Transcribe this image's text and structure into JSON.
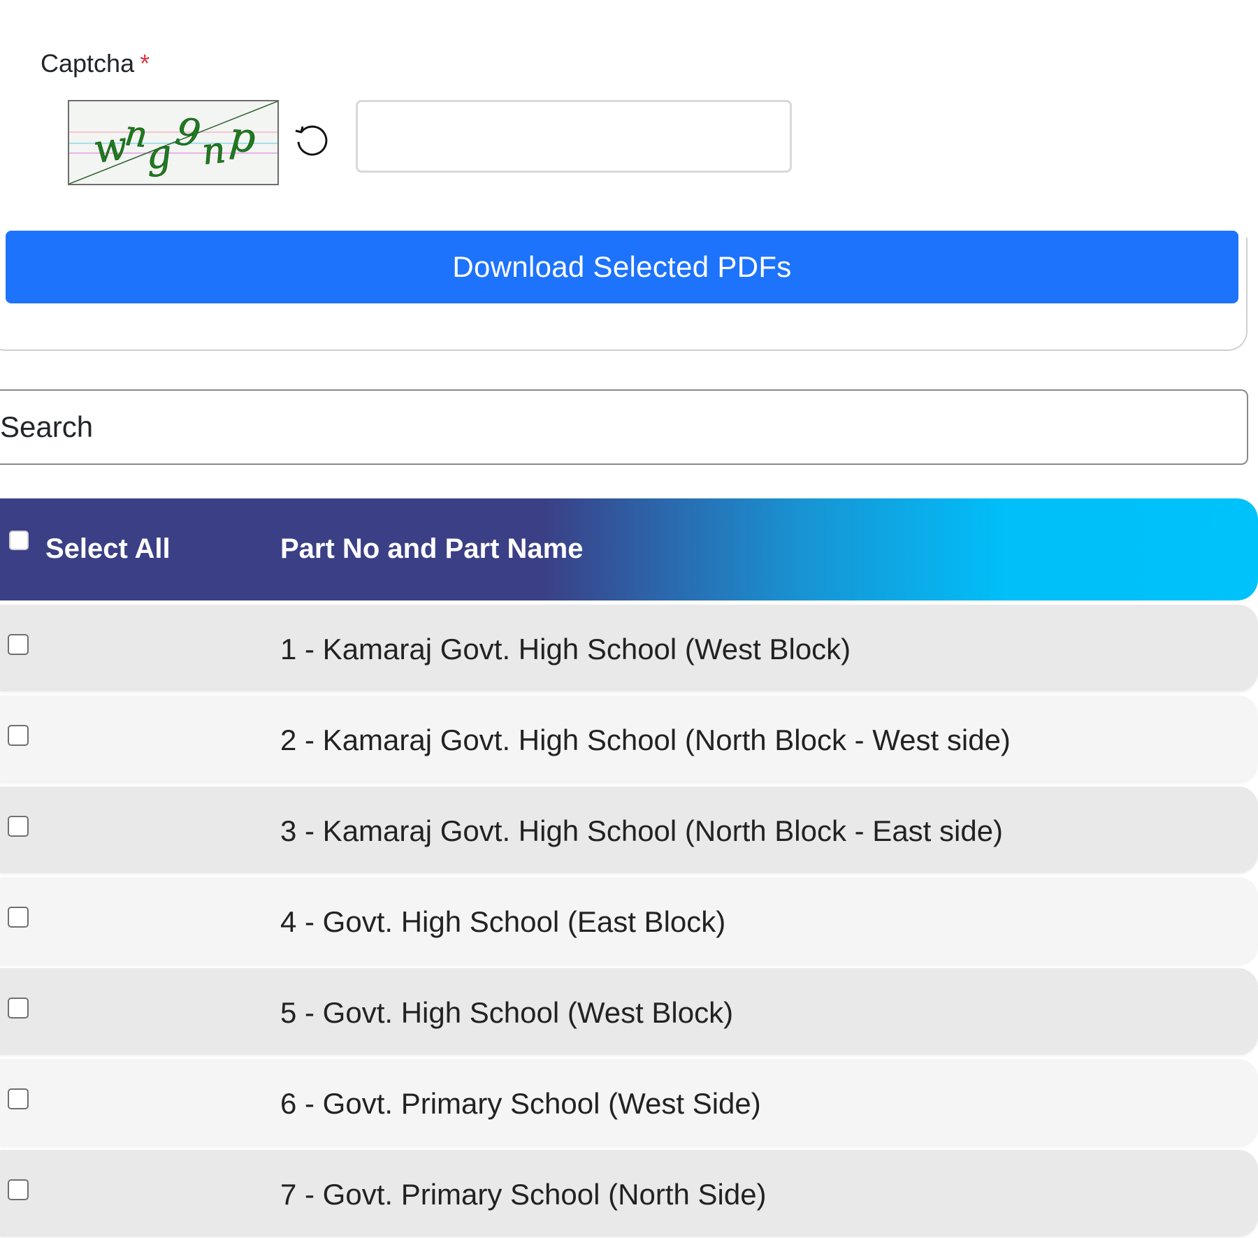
{
  "captcha": {
    "label": "Captcha",
    "required_marker": "*",
    "input_value": "",
    "image_text": "wng9np",
    "refresh_icon": "refresh-icon"
  },
  "download": {
    "button_label": "Download Selected PDFs"
  },
  "search": {
    "placeholder": "Search",
    "value": ""
  },
  "table": {
    "header": {
      "select_all_label": "Select All",
      "part_column_label": "Part No and Part Name"
    },
    "rows": [
      {
        "label": "1 - Kamaraj Govt. High School (West Block)",
        "checked": false
      },
      {
        "label": "2 - Kamaraj Govt. High School (North Block - West side)",
        "checked": false
      },
      {
        "label": "3 - Kamaraj Govt. High School (North Block - East side)",
        "checked": false
      },
      {
        "label": "4 - Govt. High School (East Block)",
        "checked": false
      },
      {
        "label": "5 - Govt. High School (West Block)",
        "checked": false
      },
      {
        "label": "6 - Govt. Primary School (West Side)",
        "checked": false
      },
      {
        "label": "7 - Govt. Primary School (North Side)",
        "checked": false
      }
    ]
  },
  "colors": {
    "primary_button": "#1e73fc",
    "header_dark": "#3b3f85",
    "header_light": "#00c2fb",
    "required": "#dc3545",
    "captcha_text": "#1a7a1a"
  }
}
